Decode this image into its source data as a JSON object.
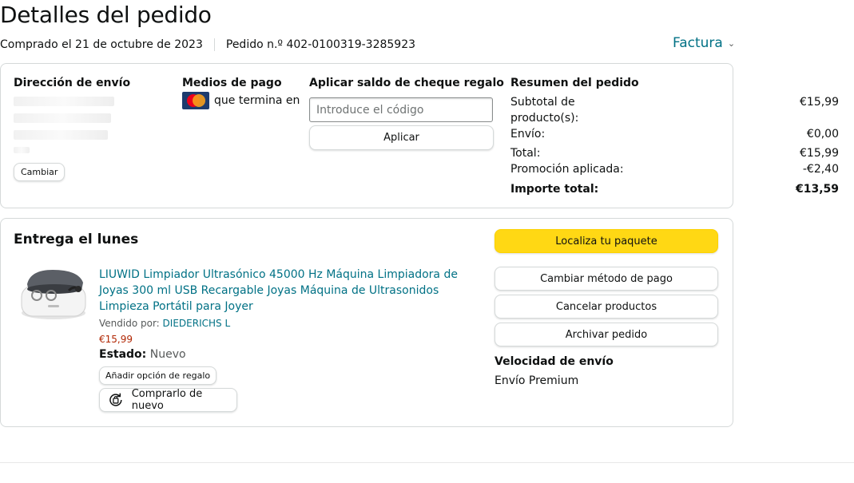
{
  "header": {
    "title": "Detalles del pedido",
    "purchased": "Comprado el 21 de octubre de 2023",
    "order_number": "Pedido n.º 402-0100319-3285923",
    "invoice_label": "Factura"
  },
  "summary_card": {
    "shipping_address": {
      "title": "Dirección de envío",
      "change_label": "Cambiar"
    },
    "payment": {
      "title": "Medios de pago",
      "card_text": "que termina en",
      "card_brand_icon": "mastercard-icon"
    },
    "gift_card": {
      "title": "Aplicar saldo de cheque regalo",
      "placeholder": "Introduce el código",
      "apply_label": "Aplicar"
    },
    "order_summary": {
      "title": "Resumen del pedido",
      "rows": [
        {
          "label": "Subtotal de",
          "label2": "producto(s):",
          "value": "€15,99"
        },
        {
          "label": "Envío:",
          "value": "€0,00"
        },
        {
          "label": "Total:",
          "value": "€15,99"
        },
        {
          "label": "Promoción aplicada:",
          "value": "-€2,40"
        },
        {
          "label": "Importe total:",
          "value": "€13,59"
        }
      ]
    }
  },
  "delivery_card": {
    "title": "Entrega el lunes",
    "product": {
      "title": "LIUWID Limpiador Ultrasónico 45000 Hz Máquina Limpiadora de Joyas 300 ml USB Recargable Joyas Máquina de Ultrasonidos Limpieza Portátil para Joyer",
      "sold_by_label": "Vendido por:",
      "seller": "DIEDERICHS L",
      "price": "€15,99",
      "state_label": "Estado:",
      "state_value": "Nuevo",
      "gift_option_label": "Añadir opción de regalo",
      "rebuy_label": "Comprarlo de nuevo"
    },
    "actions": {
      "track": "Localiza tu paquete",
      "change_payment": "Cambiar método de pago",
      "cancel": "Cancelar productos",
      "archive": "Archivar pedido"
    },
    "shipping_speed": {
      "title": "Velocidad de envío",
      "value": "Envío Premium"
    }
  },
  "colors": {
    "link": "#007185",
    "price": "#b12704",
    "primary_button": "#ffd814",
    "border": "#d5d9d9"
  }
}
